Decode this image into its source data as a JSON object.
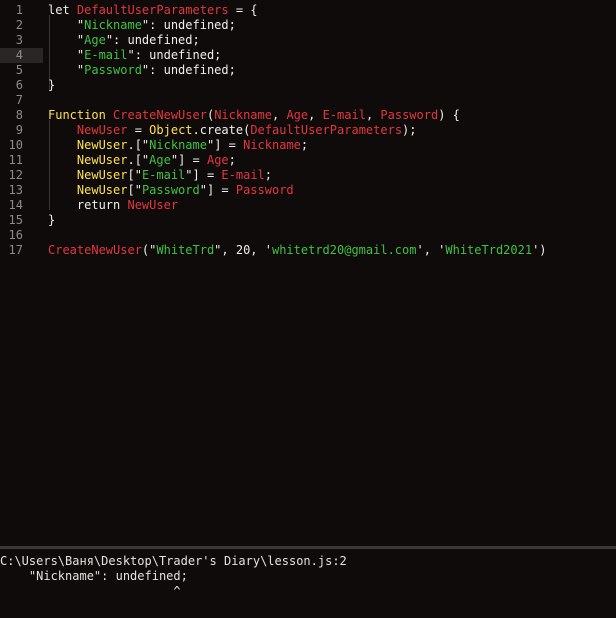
{
  "editor": {
    "highlighted_line": 4,
    "lines": [
      {
        "no": "1",
        "tokens": [
          {
            "t": "let ",
            "c": "kw"
          },
          {
            "t": "DefaultUserParameters",
            "c": "red"
          },
          {
            "t": " = {",
            "c": "txt"
          }
        ]
      },
      {
        "no": "2",
        "tokens": [
          {
            "t": "    \"",
            "c": "txt"
          },
          {
            "t": "Nickname",
            "c": "str"
          },
          {
            "t": "\": undefined;",
            "c": "txt"
          }
        ]
      },
      {
        "no": "3",
        "tokens": [
          {
            "t": "    \"",
            "c": "txt"
          },
          {
            "t": "Age",
            "c": "str"
          },
          {
            "t": "\": undefined;",
            "c": "txt"
          }
        ]
      },
      {
        "no": "4",
        "tokens": [
          {
            "t": "    \"",
            "c": "txt"
          },
          {
            "t": "E-mail",
            "c": "str"
          },
          {
            "t": "\": undefined;",
            "c": "txt"
          }
        ]
      },
      {
        "no": "5",
        "tokens": [
          {
            "t": "    \"",
            "c": "txt"
          },
          {
            "t": "Password",
            "c": "str"
          },
          {
            "t": "\": undefined;",
            "c": "txt"
          }
        ]
      },
      {
        "no": "6",
        "tokens": [
          {
            "t": "}",
            "c": "txt"
          }
        ]
      },
      {
        "no": "7",
        "tokens": []
      },
      {
        "no": "8",
        "tokens": [
          {
            "t": "Function ",
            "c": "fn"
          },
          {
            "t": "CreateNewUser",
            "c": "red"
          },
          {
            "t": "(",
            "c": "txt"
          },
          {
            "t": "Nickname",
            "c": "red"
          },
          {
            "t": ", ",
            "c": "txt"
          },
          {
            "t": "Age",
            "c": "red"
          },
          {
            "t": ", ",
            "c": "txt"
          },
          {
            "t": "E-mail",
            "c": "red"
          },
          {
            "t": ", ",
            "c": "txt"
          },
          {
            "t": "Password",
            "c": "red"
          },
          {
            "t": ") {",
            "c": "txt"
          }
        ]
      },
      {
        "no": "9",
        "tokens": [
          {
            "t": "    ",
            "c": "txt"
          },
          {
            "t": "NewUser",
            "c": "red"
          },
          {
            "t": " = ",
            "c": "txt"
          },
          {
            "t": "Object",
            "c": "fn"
          },
          {
            "t": ".create(",
            "c": "txt"
          },
          {
            "t": "DefaultUserParameters",
            "c": "red"
          },
          {
            "t": ");",
            "c": "txt"
          }
        ]
      },
      {
        "no": "10",
        "tokens": [
          {
            "t": "    ",
            "c": "txt"
          },
          {
            "t": "NewUser",
            "c": "fn"
          },
          {
            "t": ".[\"",
            "c": "txt"
          },
          {
            "t": "Nickname",
            "c": "str"
          },
          {
            "t": "\"] = ",
            "c": "txt"
          },
          {
            "t": "Nickname",
            "c": "red"
          },
          {
            "t": ";",
            "c": "txt"
          }
        ]
      },
      {
        "no": "11",
        "tokens": [
          {
            "t": "    ",
            "c": "txt"
          },
          {
            "t": "NewUser",
            "c": "fn"
          },
          {
            "t": ".[\"",
            "c": "txt"
          },
          {
            "t": "Age",
            "c": "str"
          },
          {
            "t": "\"] = ",
            "c": "txt"
          },
          {
            "t": "Age",
            "c": "red"
          },
          {
            "t": ";",
            "c": "txt"
          }
        ]
      },
      {
        "no": "12",
        "tokens": [
          {
            "t": "    ",
            "c": "txt"
          },
          {
            "t": "NewUser",
            "c": "fn"
          },
          {
            "t": "[\"",
            "c": "txt"
          },
          {
            "t": "E-mail",
            "c": "str"
          },
          {
            "t": "\"] = ",
            "c": "txt"
          },
          {
            "t": "E-mail",
            "c": "red"
          },
          {
            "t": ";",
            "c": "txt"
          }
        ]
      },
      {
        "no": "13",
        "tokens": [
          {
            "t": "    ",
            "c": "txt"
          },
          {
            "t": "NewUser",
            "c": "fn"
          },
          {
            "t": "[\"",
            "c": "txt"
          },
          {
            "t": "Password",
            "c": "str"
          },
          {
            "t": "\"] = ",
            "c": "txt"
          },
          {
            "t": "Password",
            "c": "red"
          }
        ]
      },
      {
        "no": "14",
        "tokens": [
          {
            "t": "    return ",
            "c": "kw"
          },
          {
            "t": "NewUser",
            "c": "red"
          }
        ]
      },
      {
        "no": "15",
        "tokens": [
          {
            "t": "}",
            "c": "txt"
          }
        ]
      },
      {
        "no": "16",
        "tokens": []
      },
      {
        "no": "17",
        "tokens": [
          {
            "t": "CreateNewUser",
            "c": "red"
          },
          {
            "t": "(\"",
            "c": "txt"
          },
          {
            "t": "WhiteTrd",
            "c": "str"
          },
          {
            "t": "\", 20, '",
            "c": "txt"
          },
          {
            "t": "whitetrd20@gmail.com",
            "c": "str"
          },
          {
            "t": "', '",
            "c": "txt"
          },
          {
            "t": "WhiteTrd2021",
            "c": "str"
          },
          {
            "t": "')",
            "c": "txt"
          }
        ]
      }
    ]
  },
  "console": {
    "lines": [
      "C:\\Users\\Ваня\\Desktop\\Trader's Diary\\lesson.js:2",
      "    \"Nickname\": undefined;",
      "                        ^"
    ]
  },
  "colors": {
    "background": "#0f0b0b",
    "keyword": "#f0efe9",
    "function": "#ffe14d",
    "identifier": "#e3373f",
    "string": "#3fc33f",
    "line_number": "#8d8a86",
    "current_line": "#2a2626"
  }
}
